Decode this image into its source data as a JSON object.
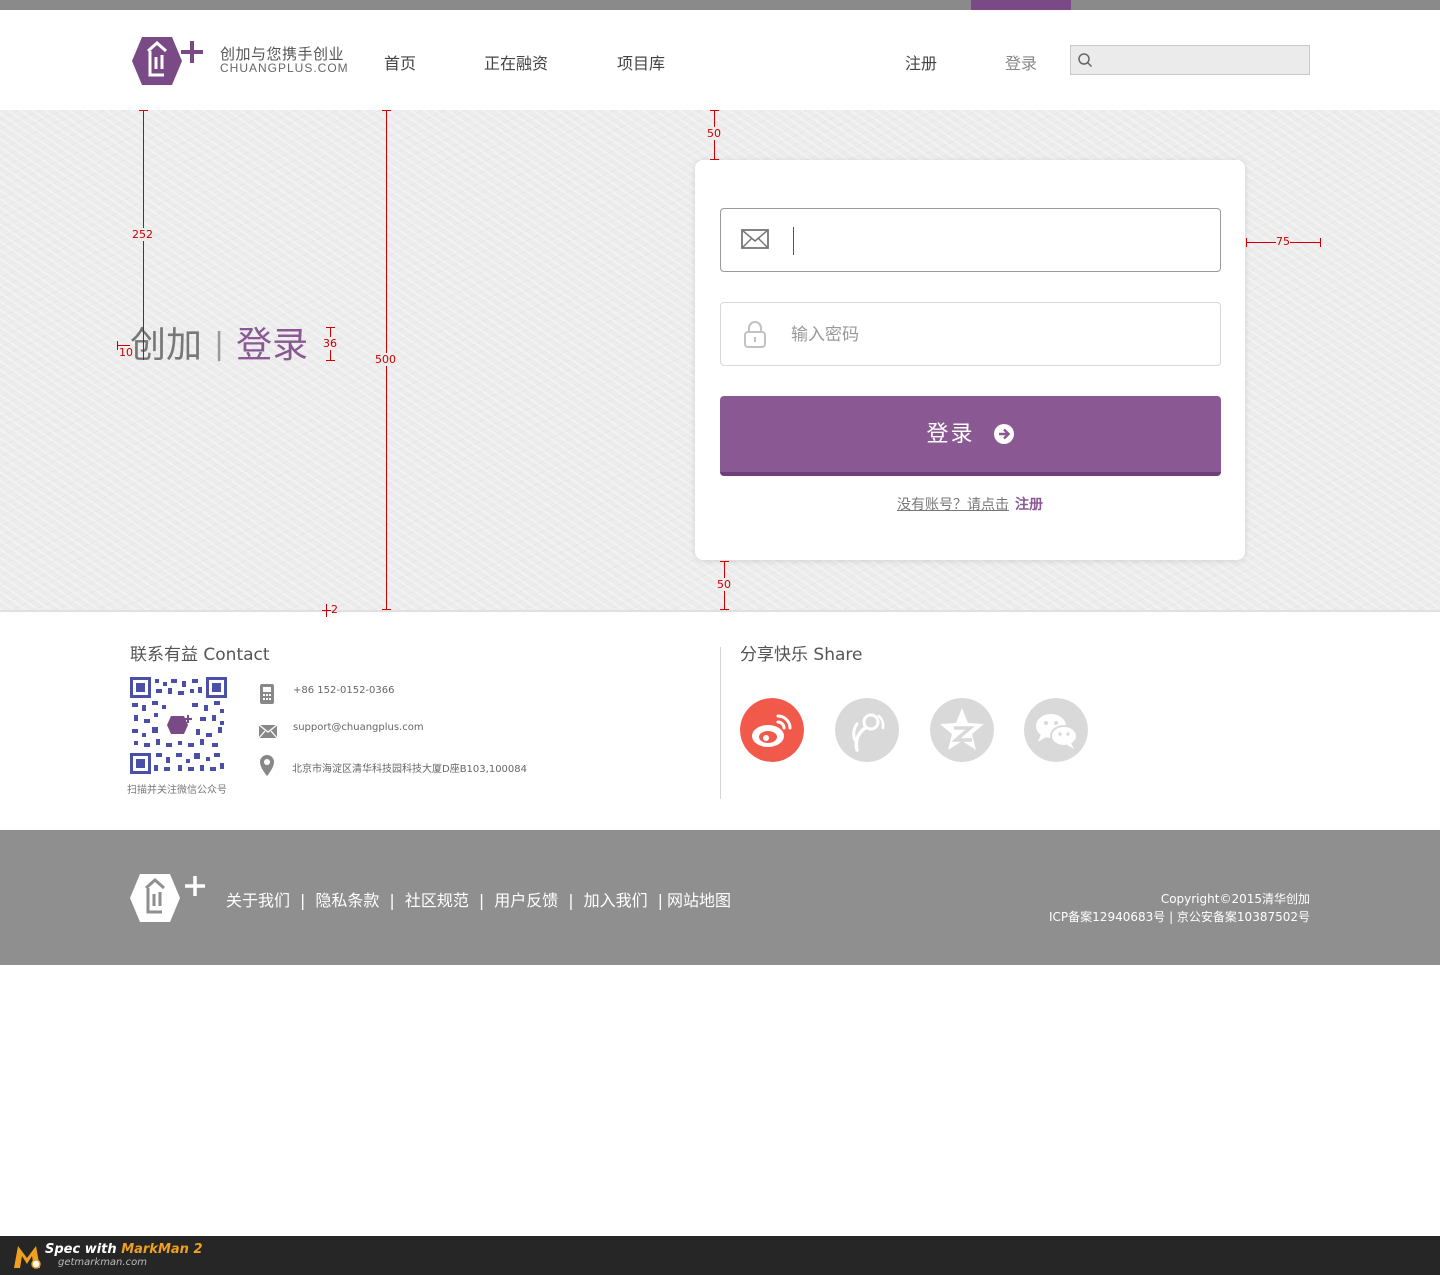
{
  "header": {
    "logo_tagline": "创加与您携手创业",
    "logo_domain": "CHUANGPLUS.COM",
    "nav": {
      "home": "首页",
      "funding": "正在融资",
      "projects": "项目库",
      "register": "注册",
      "login": "登录"
    },
    "search_placeholder": ""
  },
  "colors": {
    "brand_purple": "#8a5993",
    "topstrip_active": "#7a4a86",
    "weibo_red": "#f15a4a",
    "footer_gray": "#8f8f8f"
  },
  "hero": {
    "title_main": "创加",
    "title_separator": "|",
    "title_accent": "登录"
  },
  "login_form": {
    "email_value": "",
    "email_placeholder": "",
    "password_placeholder": "输入密码",
    "submit_label": "登录",
    "no_account_text": "没有账号？请点击",
    "register_link": "注册"
  },
  "contact": {
    "title": "联系有益 Contact",
    "qr_caption": "扫描并关注微信公众号",
    "phone": "+86 152-0152-0366",
    "email": "support@chuangplus.com",
    "address": "北京市海淀区清华科技园科技大厦D座B103,100084"
  },
  "share": {
    "title": "分享快乐 Share",
    "icons": [
      "weibo-icon",
      "tencent-weibo-icon",
      "qzone-icon",
      "wechat-icon"
    ]
  },
  "footer": {
    "links": [
      "关于我们",
      "隐私条款",
      "社区规范",
      "用户反馈",
      "加入我们",
      "网站地图"
    ],
    "separator": "|",
    "copyright": "Copyright©2015清华创加",
    "icp": "ICP备案12940683号 | 京公安备案10387502号"
  },
  "markman": {
    "spec_prefix": "Spec with",
    "product": "MarkMan 2",
    "url": "getmarkman.com"
  },
  "measurements": {
    "hero_top_offset": "252",
    "hero_height": "500",
    "title_size": "36",
    "title_left_gap": "10",
    "bottom_gap": "2",
    "card_top_gap": "50",
    "card_right_gap": "75",
    "card_bottom_gap": "50"
  }
}
